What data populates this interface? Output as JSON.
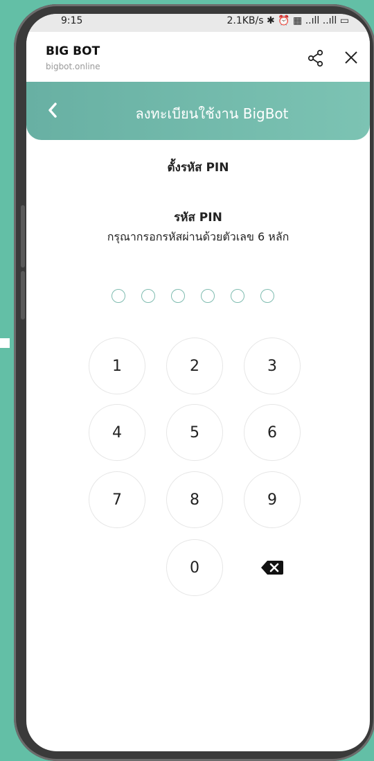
{
  "status_bar": {
    "time": "9:15",
    "right_text": "2.1KB/s ✱ ⏰ ▦ ..ıll ..ıll ▭"
  },
  "browser": {
    "site_name": "BIG BOT",
    "site_url": "bigbot.online",
    "share_icon": "share-icon",
    "close_icon": "close-icon"
  },
  "header": {
    "title": "ลงทะเบียนใช้งาน BigBot",
    "back_icon": "chevron-left-icon",
    "color": "#6eb6a8"
  },
  "page": {
    "title": "ตั้งรหัส PIN",
    "pin_label": "รหัส PIN",
    "pin_instruction": "กรุณากรอกรหัสผ่านด้วยตัวเลข 6 หลัก",
    "pin_length": 6,
    "pin_filled": 0
  },
  "keypad": {
    "keys": [
      "1",
      "2",
      "3",
      "4",
      "5",
      "6",
      "7",
      "8",
      "9",
      "0"
    ],
    "delete_icon": "backspace-icon"
  },
  "colors": {
    "background": "#63bfa6",
    "accent": "#7fbcb0"
  }
}
